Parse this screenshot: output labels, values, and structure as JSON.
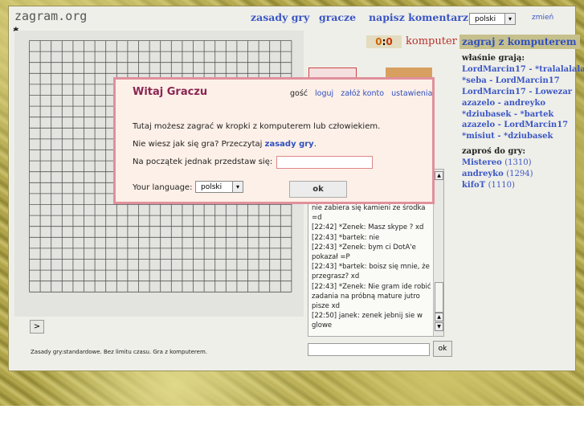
{
  "site": {
    "title": "zagram.org"
  },
  "nav": {
    "rules": "zasady gry",
    "players": "gracze",
    "comment": "napisz komentarz",
    "change": "zmień"
  },
  "top_language": {
    "selected": "polski"
  },
  "score": {
    "player": "0",
    "separator": ":",
    "computer": "0",
    "computer_label": "komputer"
  },
  "sidebar": {
    "play_computer": "zagraj z komputerem",
    "now_playing_header": "właśnie grają:",
    "now_playing": [
      "LordMarcin17 - *tralalalala",
      "*seba - LordMarcin17",
      "LordMarcin17 - Lowezar",
      "azazelo - andreyko",
      "*dziubasek - *bartek",
      "azazelo - LordMarcin17",
      "*misiut - *dziubasek"
    ],
    "invite_header": "zaproś do gry:",
    "invite": [
      {
        "name": "Mistereo",
        "rating": "(1310)"
      },
      {
        "name": "andreyko",
        "rating": "(1294)"
      },
      {
        "name": "kifoT",
        "rating": "(1110)"
      }
    ]
  },
  "chat": {
    "lines": [
      "nie zabiera się kamieni ze środka =d",
      "[22:42] *Zenek: Masz skype ? xd",
      "[22:43] *bartek: nie",
      "[22:43] *Zenek: bym ci DotA'e pokazał =P",
      "[22:43] *bartek: boisz się mnie, że przegrasz? xd",
      "[22:43] *Zenek: Nie gram ide robić zadania na próbną mature jutro pisze xd",
      "[22:50] janek: zenek jebnij sie w glowe"
    ],
    "ok_label": "ok"
  },
  "board": {
    "next_label": ">",
    "footer": "Zasady gry:standardowe. Bez limitu czasu. Gra z komputerem."
  },
  "modal": {
    "title": "Witaj Graczu",
    "guest": "gość",
    "login": "loguj",
    "register": "załóż konto",
    "settings": "ustawienia",
    "line1": "Tutaj możesz zagrać w kropki z komputerem lub człowiekiem.",
    "line2_prefix": "Nie wiesz jak się gra? Przeczytaj ",
    "line2_link": "zasady gry",
    "line2_suffix": ".",
    "line3": "Na początek jednak przedstaw się:",
    "language_label": "Your language:",
    "language_selected": "polski",
    "ok_label": "ok"
  },
  "colors": {
    "accent": "#3a56c5",
    "modal_border": "#e0909c",
    "title": "#8a2552"
  }
}
